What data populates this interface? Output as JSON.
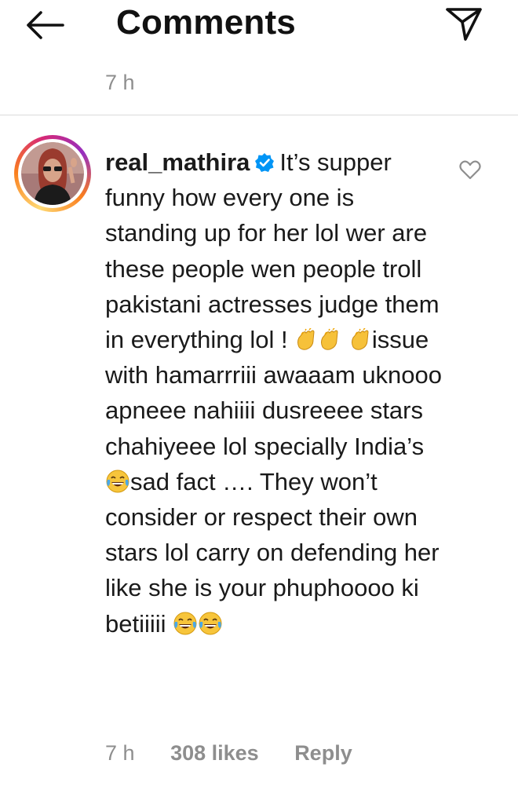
{
  "header": {
    "title": "Comments",
    "back_icon": "arrow-left-icon",
    "send_icon": "paper-plane-icon"
  },
  "post": {
    "time": "7 h"
  },
  "comment": {
    "username": "real_mathira",
    "verified_icon": "verified-badge-icon",
    "text_parts": [
      "It’s supper funny how every one is standing up for her lol wer are these people wen people troll pakistani actresses judge them in everything lol !",
      "issue with hamarrriii awaaam uknooo apneee nahiiii dusreeee stars chahiyeee lol specially India’s",
      "sad fact …. They won’t consider or respect their own stars lol carry on defending her like she is your phuphoooo ki betiiiii"
    ],
    "emojis": [
      "clapping-hands",
      "clapping-hands",
      "clapping-hands",
      "face-with-tears-of-joy",
      "face-with-tears-of-joy",
      "face-with-tears-of-joy"
    ],
    "time": "7 h",
    "likes": "308 likes",
    "reply_label": "Reply",
    "like_icon": "heart-outline-icon"
  },
  "colors": {
    "text": "#262626",
    "muted": "#8e8e8e",
    "verified": "#0095f6",
    "divider": "#dbdbdb"
  }
}
